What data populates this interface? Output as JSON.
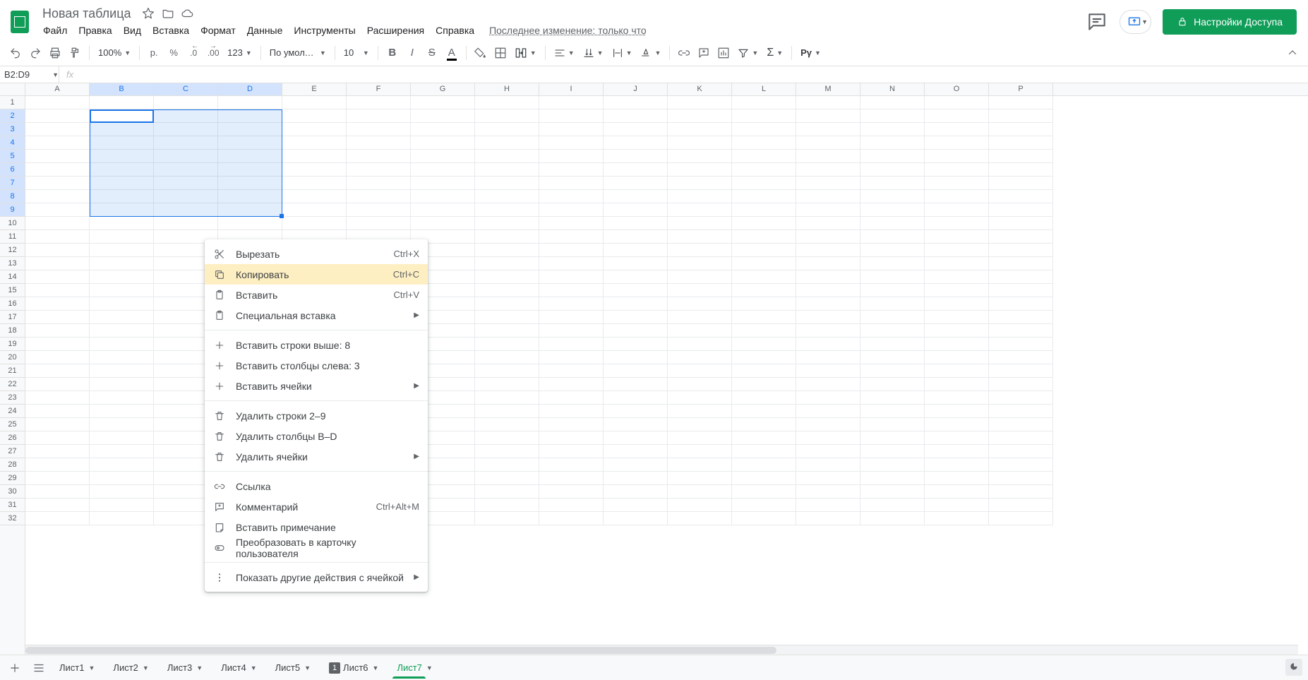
{
  "header": {
    "doc_name": "Новая таблица",
    "last_edit": "Последнее изменение: только что",
    "share_label": "Настройки Доступа"
  },
  "menus": [
    "Файл",
    "Правка",
    "Вид",
    "Вставка",
    "Формат",
    "Данные",
    "Инструменты",
    "Расширения",
    "Справка"
  ],
  "toolbar": {
    "zoom": "100%",
    "currency": "р.",
    "percent": "%",
    "dec_dec": ".0",
    "inc_dec": ".00",
    "format_123": "123",
    "font": "По умолча...",
    "font_size": "10",
    "py_label": "Pγ"
  },
  "namebox": "B2:D9",
  "fx_label": "fx",
  "columns": [
    "A",
    "B",
    "C",
    "D",
    "E",
    "F",
    "G",
    "H",
    "I",
    "J",
    "K",
    "L",
    "M",
    "N",
    "O",
    "P"
  ],
  "selected_cols": [
    "B",
    "C",
    "D"
  ],
  "rows": 32,
  "selected_rows": [
    2,
    3,
    4,
    5,
    6,
    7,
    8,
    9
  ],
  "ctx": {
    "cut": {
      "label": "Вырезать",
      "short": "Ctrl+X"
    },
    "copy": {
      "label": "Копировать",
      "short": "Ctrl+C"
    },
    "paste": {
      "label": "Вставить",
      "short": "Ctrl+V"
    },
    "pspecial": {
      "label": "Специальная вставка"
    },
    "ins_rows": {
      "label": "Вставить строки выше: 8"
    },
    "ins_cols": {
      "label": "Вставить столбцы слева: 3"
    },
    "ins_cells": {
      "label": "Вставить ячейки"
    },
    "del_rows": {
      "label": "Удалить строки 2–9"
    },
    "del_cols": {
      "label": "Удалить столбцы B–D"
    },
    "del_cells": {
      "label": "Удалить ячейки"
    },
    "link": {
      "label": "Ссылка"
    },
    "comment": {
      "label": "Комментарий",
      "short": "Ctrl+Alt+M"
    },
    "note": {
      "label": "Вставить примечание"
    },
    "smartchip": {
      "label": "Преобразовать в карточку пользователя"
    },
    "more": {
      "label": "Показать другие действия с ячейкой"
    }
  },
  "sheets": [
    {
      "name": "Лист1"
    },
    {
      "name": "Лист2"
    },
    {
      "name": "Лист3"
    },
    {
      "name": "Лист4"
    },
    {
      "name": "Лист5"
    },
    {
      "name": "Лист6",
      "badge": "1"
    },
    {
      "name": "Лист7",
      "active": true
    }
  ]
}
